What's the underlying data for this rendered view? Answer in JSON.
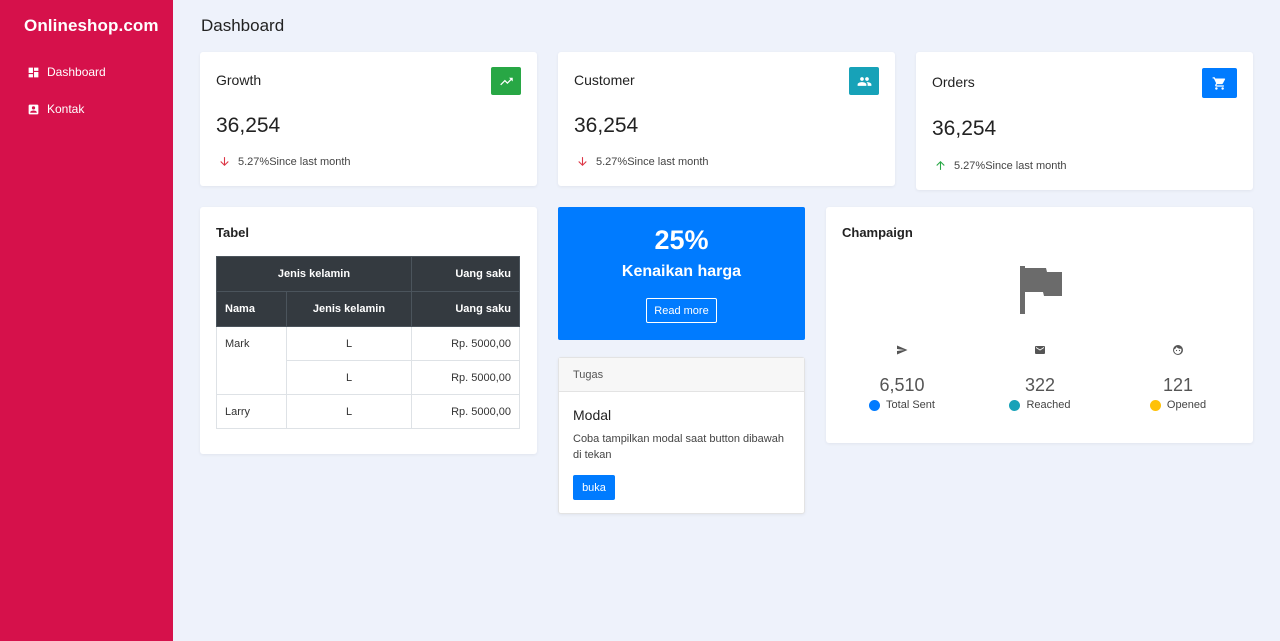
{
  "sidebar": {
    "brand": "Onlineshop.com",
    "items": [
      {
        "label": "Dashboard",
        "icon": "dashboard-icon"
      },
      {
        "label": "Kontak",
        "icon": "contact-icon"
      }
    ],
    "color": "#d6114b"
  },
  "header": {
    "title": "Dashboard"
  },
  "stats": [
    {
      "title": "Growth",
      "value": "36,254",
      "trend_value": "5.27%",
      "trend_text": "Since last month",
      "direction": "down",
      "icon": "trending-up-icon",
      "icon_color": "#28a745"
    },
    {
      "title": "Customer",
      "value": "36,254",
      "trend_value": "5.27%",
      "trend_text": "Since last month",
      "direction": "down",
      "icon": "people-icon",
      "icon_color": "#17a2b8"
    },
    {
      "title": "Orders",
      "value": "36,254",
      "trend_value": "5.27%",
      "trend_text": "Since last month",
      "direction": "up",
      "icon": "cart-icon",
      "icon_color": "#007bff"
    }
  ],
  "table": {
    "title": "Tabel",
    "header_row1": [
      "Jenis kelamin",
      "Uang saku"
    ],
    "header_row2": [
      "Nama",
      "Jenis kelamin",
      "Uang saku"
    ],
    "rows": [
      {
        "nama": "Mark",
        "jk": "L",
        "uang": "Rp. 5000,00"
      },
      {
        "nama": "",
        "jk": "L",
        "uang": "Rp. 5000,00"
      },
      {
        "nama": "Larry",
        "jk": "L",
        "uang": "Rp. 5000,00"
      }
    ]
  },
  "promo": {
    "percent": "25%",
    "text": "Kenaikan harga",
    "button": "Read more",
    "color": "#007bff"
  },
  "task": {
    "header": "Tugas",
    "title": "Modal",
    "text": "Coba tampilkan modal saat button dibawah di tekan",
    "button": "buka"
  },
  "campaign": {
    "title": "Champaign",
    "icon": "flag-icon",
    "stats": [
      {
        "value": "6,510",
        "label": "Total Sent",
        "icon": "send-icon",
        "color": "#007bff"
      },
      {
        "value": "322",
        "label": "Reached",
        "icon": "mail-icon",
        "color": "#17a2b8"
      },
      {
        "value": "121",
        "label": "Opened",
        "icon": "face-icon",
        "color": "#ffc107"
      }
    ]
  }
}
